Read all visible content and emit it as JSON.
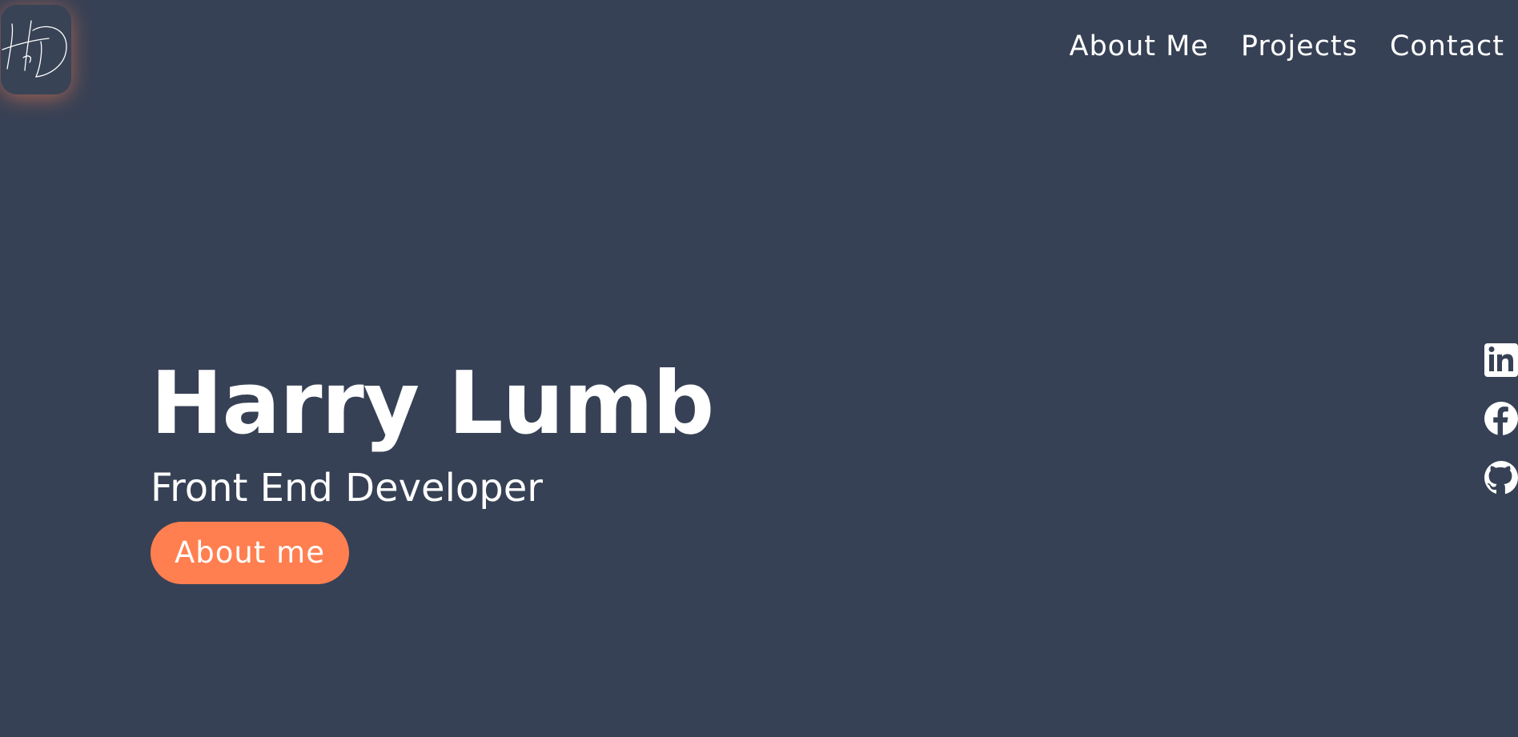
{
  "header": {
    "logo_icon": "hd-signature-logo-icon",
    "nav": [
      {
        "label": "About Me"
      },
      {
        "label": "Projects"
      },
      {
        "label": "Contact"
      }
    ]
  },
  "hero": {
    "title": "Harry Lumb",
    "subtitle": "Front End Developer",
    "button_label": "About me"
  },
  "social": [
    {
      "icon": "linkedin-icon"
    },
    {
      "icon": "facebook-icon"
    },
    {
      "icon": "github-icon"
    }
  ],
  "colors": {
    "background": "#374155",
    "accent": "#ff7f50",
    "text": "#ffffff"
  }
}
